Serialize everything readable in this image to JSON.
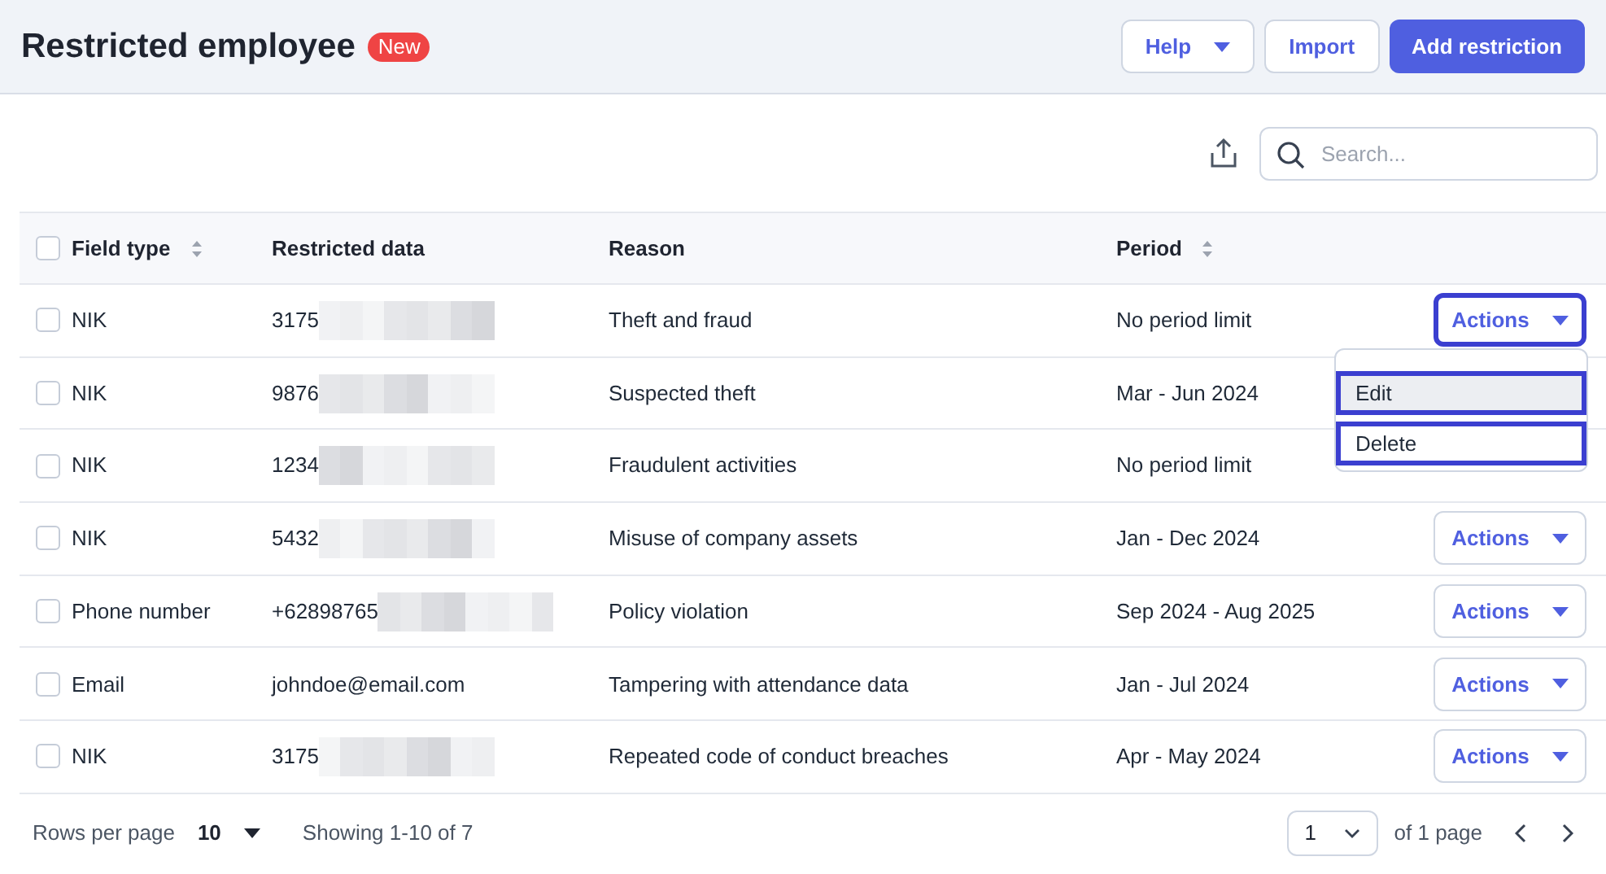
{
  "header": {
    "title": "Restricted employee",
    "badge": "New",
    "buttons": [
      {
        "label": "Help",
        "kind": "dropdown"
      },
      {
        "label": "Import",
        "kind": "outline"
      },
      {
        "label": "Add restriction",
        "kind": "primary"
      }
    ]
  },
  "toolbar": {
    "search": {
      "placeholder": "Search..."
    }
  },
  "table": {
    "select_all": {
      "checked": false
    },
    "columns": [
      {
        "label": "Field type",
        "sortable": true
      },
      {
        "label": "Restricted data",
        "sortable": false
      },
      {
        "label": "Reason",
        "sortable": false
      },
      {
        "label": "Period",
        "sortable": true
      }
    ],
    "rows": [
      {
        "checked": false,
        "field_type": "NIK",
        "data": "3175",
        "redacted": true,
        "reason": "Theft and fraud",
        "period": "No period limit",
        "actions": "Actions",
        "highlighted": true
      },
      {
        "checked": false,
        "field_type": "NIK",
        "data": "9876",
        "redacted": true,
        "reason": "Suspected theft",
        "period": "Mar - Jun 2024"
      },
      {
        "checked": false,
        "field_type": "NIK",
        "data": "1234",
        "redacted": true,
        "reason": "Fraudulent activities",
        "period": "No period limit"
      },
      {
        "checked": false,
        "field_type": "NIK",
        "data": "5432",
        "redacted": true,
        "reason": "Misuse of company assets",
        "period": "Jan - Dec 2024",
        "actions": "Actions",
        "highlighted": false
      },
      {
        "checked": false,
        "field_type": "Phone number",
        "data": "+62898765",
        "redacted": true,
        "reason": "Policy violation",
        "period": "Sep 2024 - Aug 2025",
        "actions": "Actions",
        "highlighted": false
      },
      {
        "checked": false,
        "field_type": "Email",
        "data": "johndoe@email.com",
        "redacted": false,
        "reason": "Tampering with attendance data",
        "period": "Jan - Jul 2024",
        "actions": "Actions",
        "highlighted": false
      },
      {
        "checked": false,
        "field_type": "NIK",
        "data": "3175",
        "redacted": true,
        "reason": "Repeated code of conduct breaches",
        "period": "Apr - May 2024",
        "actions": "Actions",
        "highlighted": false
      }
    ]
  },
  "actions_menu": {
    "items": [
      {
        "label": "Edit",
        "hovered": true,
        "highlighted": true
      },
      {
        "label": "Delete",
        "hovered": false,
        "highlighted": true
      }
    ]
  },
  "footer": {
    "rows_per_page_label": "Rows per page",
    "rows_per_page": "10",
    "showing": "Showing 1-10 of 7",
    "page": "1",
    "page_count": "of 1 page"
  }
}
